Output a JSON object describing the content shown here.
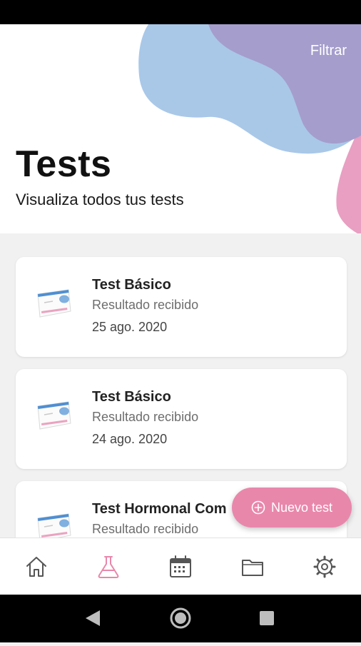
{
  "header": {
    "filter_label": "Filtrar",
    "title": "Tests",
    "subtitle": "Visualiza todos tus tests"
  },
  "tests": [
    {
      "title": "Test Básico",
      "status": "Resultado recibido",
      "date": "25 ago. 2020"
    },
    {
      "title": "Test Básico",
      "status": "Resultado recibido",
      "date": "24 ago. 2020"
    },
    {
      "title": "Test Hormonal Com",
      "status": "Resultado recibido",
      "date": ""
    }
  ],
  "fab": {
    "label": "Nuevo test",
    "icon": "plus-circle-icon"
  },
  "bottom_nav": {
    "items": [
      {
        "icon": "home-icon",
        "active": false
      },
      {
        "icon": "flask-icon",
        "active": true
      },
      {
        "icon": "calendar-icon",
        "active": false
      },
      {
        "icon": "folder-icon",
        "active": false
      },
      {
        "icon": "settings-gear-icon",
        "active": false
      }
    ]
  },
  "system_nav": {
    "icons": [
      "back-icon",
      "home-circle-icon",
      "recents-square-icon"
    ]
  },
  "colors": {
    "accent_pink": "#e987ab",
    "blob_blue": "#a6c6e6",
    "blob_purple": "#a49ccb",
    "blob_pink": "#e79cc0",
    "background": "#f1f1f2"
  }
}
